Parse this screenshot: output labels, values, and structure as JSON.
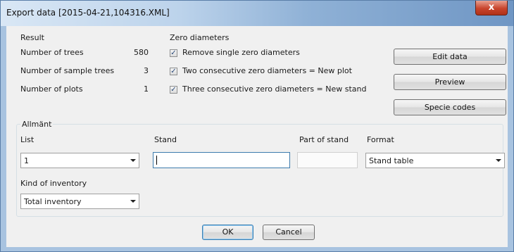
{
  "window": {
    "title": "Export data [2015-04-21,104316.XML]",
    "close_glyph": "x"
  },
  "result": {
    "label": "Result",
    "rows": [
      {
        "label": "Number of trees",
        "value": "580"
      },
      {
        "label": "Number of sample trees",
        "value": "3"
      },
      {
        "label": "Number of plots",
        "value": "1"
      }
    ]
  },
  "zero": {
    "label": "Zero diameters",
    "options": [
      {
        "label": "Remove single zero diameters",
        "checked": true
      },
      {
        "label": "Two consecutive zero diameters = New plot",
        "checked": true
      },
      {
        "label": "Three consecutive zero diameters = New stand",
        "checked": true
      }
    ]
  },
  "buttons": {
    "edit": "Edit data",
    "preview": "Preview",
    "species": "Specie codes",
    "ok": "OK",
    "cancel": "Cancel"
  },
  "general": {
    "label": "Allmänt",
    "list": {
      "label": "List",
      "value": "1"
    },
    "stand": {
      "label": "Stand",
      "value": ""
    },
    "part": {
      "label": "Part of stand",
      "value": ""
    },
    "format": {
      "label": "Format",
      "value": "Stand table"
    },
    "kind": {
      "label": "Kind of inventory",
      "value": "Total inventory"
    }
  }
}
